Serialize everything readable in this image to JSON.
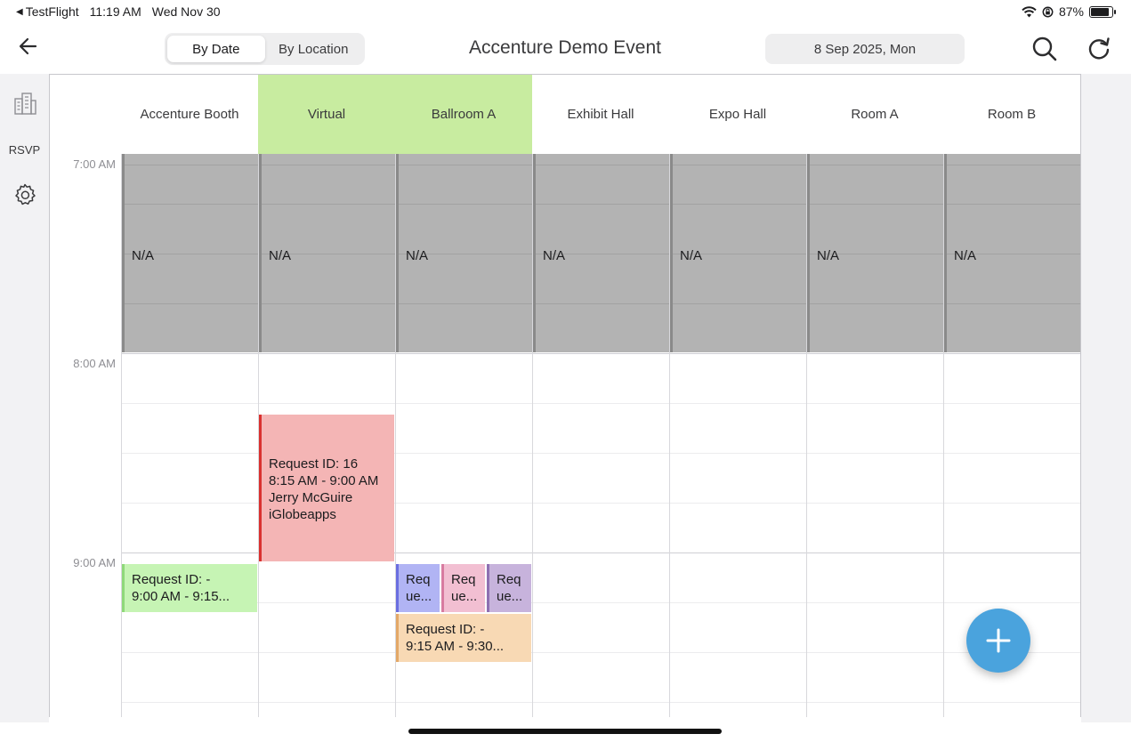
{
  "statusbar": {
    "back_app": "TestFlight",
    "time": "11:19 AM",
    "date": "Wed Nov 30",
    "battery": "87%",
    "battery_level": 0.87
  },
  "nav": {
    "segments": [
      "By Date",
      "By Location"
    ],
    "active_segment": "By Date",
    "title": "Accenture Demo Event",
    "date": "8 Sep 2025, Mon",
    "icons": {
      "back": "arrow-left-icon",
      "search": "search-icon",
      "refresh": "refresh-icon"
    }
  },
  "rail": {
    "items": [
      {
        "name": "building-icon"
      },
      {
        "label": "RSVP"
      },
      {
        "name": "gear-icon"
      }
    ]
  },
  "columns": [
    "Accenture Booth",
    "Virtual",
    "Ballroom A",
    "Exhibit Hall",
    "Expo Hall",
    "Room A",
    "Room B"
  ],
  "highlight_color": "#c8eca0",
  "times": [
    "7:00 AM",
    "8:00 AM",
    "9:00 AM"
  ],
  "unavailable_label": "N/A",
  "events": [
    {
      "id": "evt-16",
      "lines": [
        "Request ID: 16",
        "8:15 AM - 9:00 AM",
        "Jerry McGuire",
        "iGlobeapps"
      ],
      "color": "#f4b5b5",
      "accent": "#d9312f"
    },
    {
      "id": "evt-booth",
      "lines": [
        "Request ID: -",
        "9:00 AM - 9:15..."
      ],
      "color": "#c6f4b4",
      "accent": "#8fd87a"
    },
    {
      "id": "evt-b1",
      "lines": [
        "Req",
        "ue..."
      ],
      "color": "#b1b4f4",
      "accent": "#6a6ee0"
    },
    {
      "id": "evt-b2",
      "lines": [
        "Req",
        "ue..."
      ],
      "color": "#f2bfd2",
      "accent": "#d87ba0"
    },
    {
      "id": "evt-b3",
      "lines": [
        "Req",
        "ue..."
      ],
      "color": "#c7b3dc",
      "accent": "#8e6fb2"
    },
    {
      "id": "evt-b4",
      "lines": [
        "Request ID: -",
        "9:15 AM - 9:30..."
      ],
      "color": "#f8d9b4",
      "accent": "#e3a867"
    }
  ],
  "fab": {
    "icon": "plus-icon",
    "color": "#4aa3dd"
  }
}
